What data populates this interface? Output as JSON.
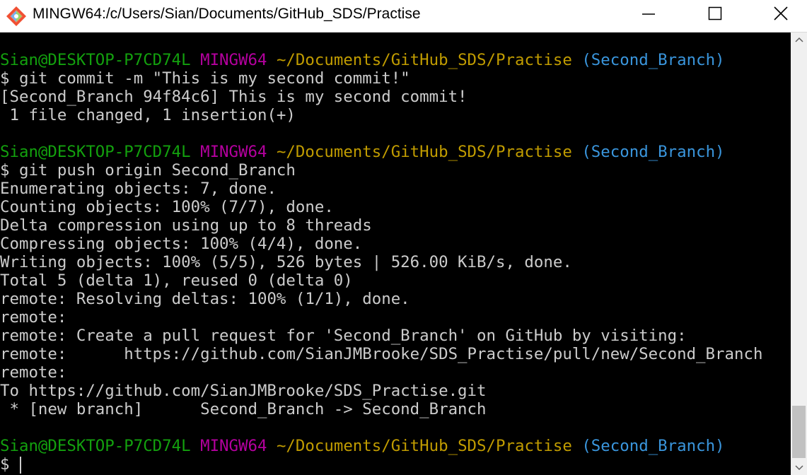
{
  "window": {
    "title": "MINGW64:/c/Users/Sian/Documents/GitHub_SDS/Practise",
    "icon": "git-bash-icon",
    "controls": [
      "minimize-icon",
      "maximize-icon",
      "close-icon"
    ]
  },
  "colors": {
    "user_host": "#13a10e",
    "shell_name": "#b4009e",
    "path": "#c19c00",
    "branch": "#3a96dd",
    "text": "#cccccc",
    "background": "#000000"
  },
  "prompt": {
    "user_host": "Sian@DESKTOP-P7CD74L",
    "shell": "MINGW64",
    "path": "~/Documents/GitHub_SDS/Practise",
    "branch": "(Second_Branch)",
    "symbol": "$"
  },
  "terminal": {
    "lines": [
      "$ git commit -m \"This is my second commit!\"",
      "[Second_Branch 94f84c6] This is my second commit!",
      " 1 file changed, 1 insertion(+)",
      "$ git push origin Second_Branch",
      "Enumerating objects: 7, done.",
      "Counting objects: 100% (7/7), done.",
      "Delta compression using up to 8 threads",
      "Compressing objects: 100% (4/4), done.",
      "Writing objects: 100% (5/5), 526 bytes | 526.00 KiB/s, done.",
      "Total 5 (delta 1), reused 0 (delta 0)",
      "remote: Resolving deltas: 100% (1/1), done.",
      "remote:",
      "remote: Create a pull request for 'Second_Branch' on GitHub by visiting:",
      "remote:      https://github.com/SianJMBrooke/SDS_Practise/pull/new/Second_Branch",
      "remote:",
      "To https://github.com/SianJMBrooke/SDS_Practise.git",
      " * [new branch]      Second_Branch -> Second_Branch"
    ]
  }
}
